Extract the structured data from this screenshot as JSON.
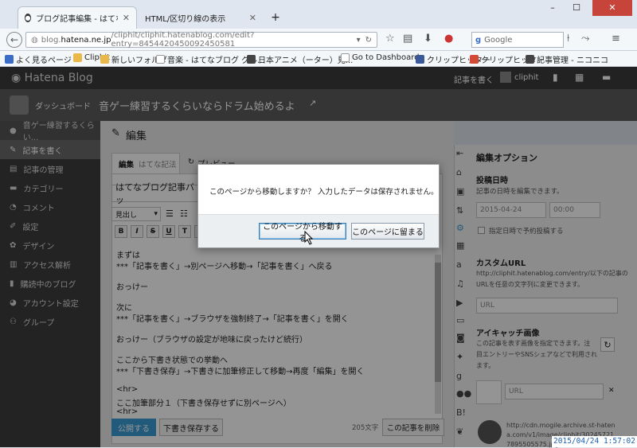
{
  "browser": {
    "tabs": [
      {
        "label": "ブログ記事編集 - はてなブログ",
        "active": true
      },
      {
        "label": "HTML/区切り線の表示",
        "active": false
      }
    ],
    "new_tab": "+",
    "url_prefix": "blog.",
    "url_host": "hatena.ne.jp",
    "url_rest": "/cliphit/cliphit.hatenablog.com/edit?entry=8454420450092450581",
    "search_engine": "Google",
    "window_controls": [
      "–",
      "☐",
      "✕"
    ]
  },
  "bookmarks": [
    {
      "label": "よく見るページ",
      "icon": "bookmark-icon",
      "color": "#3a6cc8"
    },
    {
      "label": "Cliphit",
      "icon": "folder-icon",
      "color": "#e8b84a"
    },
    {
      "label": "新しいフォルダ",
      "icon": "folder-icon",
      "color": "#e8b84a"
    },
    {
      "label": "音楽 - はてなブログ グル...",
      "icon": "page-icon",
      "color": "#ffffff"
    },
    {
      "label": "日本アニメ（ーター）見...",
      "icon": "robot-icon",
      "color": "#444444"
    },
    {
      "label": "Go to Dashboard",
      "icon": "page-icon",
      "color": "#ffffff"
    },
    {
      "label": "クリップヒッター",
      "icon": "facebook-icon",
      "color": "#3b5998"
    },
    {
      "label": "クリップヒッター",
      "icon": "gplus-icon",
      "color": "#d34836"
    },
    {
      "label": "記事管理 - ニコニコ",
      "icon": "robot-icon",
      "color": "#444444"
    }
  ],
  "hatena": {
    "logo": "Hatena Blog",
    "write_post": "記事を書く",
    "user": "cliphit",
    "dashboard": "ダッシュボード",
    "blog_title": "音ゲー練習するくらいならドラム始めるよ"
  },
  "sidebar": {
    "items": [
      {
        "label": "音ゲー練習するくらい...",
        "icon": "blog-icon"
      },
      {
        "label": "記事を書く",
        "icon": "pencil-icon"
      },
      {
        "label": "記事の管理",
        "icon": "document-icon"
      },
      {
        "label": "カテゴリー",
        "icon": "folder-icon"
      },
      {
        "label": "コメント",
        "icon": "comment-icon"
      },
      {
        "label": "設定",
        "icon": "wrench-icon"
      },
      {
        "label": "デザイン",
        "icon": "palette-icon"
      },
      {
        "label": "アクセス解析",
        "icon": "chart-icon"
      },
      {
        "label": "購読中のブログ",
        "icon": "book-icon"
      },
      {
        "label": "アカウント設定",
        "icon": "user-icon"
      },
      {
        "label": "グループ",
        "icon": "group-icon"
      }
    ]
  },
  "editor": {
    "heading": "編集",
    "mode_label": "編集",
    "mode_value": "はてな記法",
    "preview_tab": "プレビュー",
    "title_value": "はてなブログ記事バッ",
    "heading_select": "見出し",
    "toolbar": [
      "B",
      "I",
      "S",
      "U",
      "T",
      "A"
    ],
    "lines": [
      "まずは",
      "***「記事を書く」→別ページへ移動→「記事を書く」へ戻る",
      "",
      "おっけー",
      "",
      "次に",
      "***「記事を書く」→ブラウザを強制終了→「記事を書く」を開く",
      "",
      "おっけー（ブラウザの設定が地味に戻ったけど続行）",
      "",
      "ここから下書き状態での挙動へ",
      "***「下書き保存」→下書きに加筆修正して移動→再度「編集」を開く",
      "",
      "<hr>",
      "ここ加筆部分１（下書き保存せずに別ページへ）",
      "<hr>"
    ],
    "publish": "公開する",
    "save_draft": "下書き保存する",
    "char_count": "205文字",
    "delete": "この記事を削除"
  },
  "right_panel": {
    "title": "編集オプション",
    "post_date_label": "投稿日時",
    "post_date_desc": "記事の日時を編集できます。",
    "date_value": "2015-04-24",
    "time_value": "00:00",
    "scheduled_label": "指定日時で予約投稿する",
    "custom_url_label": "カスタムURL",
    "custom_url_desc1": "http://cliphit.hatenablog.com/entry/以下の記事の",
    "custom_url_desc2": "URLを任意の文字列に変更できます。",
    "url_placeholder": "URL",
    "eyecatch_label": "アイキャッチ画像",
    "eyecatch_desc1": "この記事を表す画像を指定できます。注",
    "eyecatch_desc2": "目エントリーやSNSシェアなどで利用され",
    "eyecatch_desc3": "ます。",
    "eyecatch_url_placeholder": "URL",
    "image_url1": "http://cdn.mogile.archive.st-haten",
    "image_url2": "a.com/v1/image/cliphit/30245721",
    "image_url3": "7895505575.jpg"
  },
  "dialog": {
    "message": "このページから移動しますか？ 入力したデータは保存されません。",
    "leave_button": "このページから移動する",
    "stay_button": "このページに留まる"
  },
  "timestamp": "2015/04/24 1:57:02",
  "colors": {
    "publish_button": "#3a9bd5",
    "header_bg": "#3b3b3b",
    "sidebar_bg": "#3d3d3d"
  }
}
